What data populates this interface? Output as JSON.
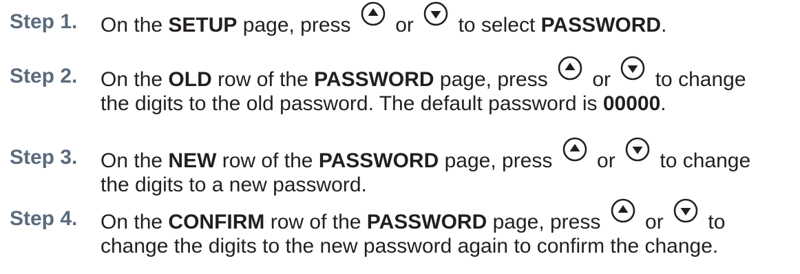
{
  "steps": [
    {
      "label": "Step 1.",
      "lines": [
        [
          {
            "t": "On the "
          },
          {
            "b": "SETUP"
          },
          {
            "t": " page, press "
          },
          {
            "icon": "up-arrow-button-icon"
          },
          {
            "t": " or "
          },
          {
            "icon": "down-arrow-button-icon"
          },
          {
            "t": " to select "
          },
          {
            "b": "PASSWORD"
          },
          {
            "t": "."
          }
        ]
      ]
    },
    {
      "label": "Step 2.",
      "lines": [
        [
          {
            "t": "On the "
          },
          {
            "b": "OLD"
          },
          {
            "t": " row of the "
          },
          {
            "b": "PASSWORD"
          },
          {
            "t": " page, press "
          },
          {
            "icon": "up-arrow-button-icon"
          },
          {
            "t": " or "
          },
          {
            "icon": "down-arrow-button-icon"
          },
          {
            "t": " to change"
          }
        ],
        [
          {
            "t": "the digits to the old password. The default password is "
          },
          {
            "b": "00000"
          },
          {
            "t": "."
          }
        ]
      ]
    },
    {
      "label": "Step 3.",
      "lines": [
        [
          {
            "t": "On the "
          },
          {
            "b": "NEW"
          },
          {
            "t": " row of the "
          },
          {
            "b": "PASSWORD"
          },
          {
            "t": " page, press "
          },
          {
            "icon": "up-arrow-button-icon"
          },
          {
            "t": " or "
          },
          {
            "icon": "down-arrow-button-icon"
          },
          {
            "t": " to change"
          }
        ],
        [
          {
            "t": "the digits to a new password."
          }
        ]
      ]
    },
    {
      "label": "Step 4.",
      "lines": [
        [
          {
            "t": "On the "
          },
          {
            "b": "CONFIRM"
          },
          {
            "t": " row of the "
          },
          {
            "b": "PASSWORD"
          },
          {
            "t": " page, press "
          },
          {
            "icon": "up-arrow-button-icon"
          },
          {
            "t": " or "
          },
          {
            "icon": "down-arrow-button-icon"
          },
          {
            "t": " to"
          }
        ],
        [
          {
            "t": "change the digits to the new password again to confirm the change."
          }
        ]
      ]
    }
  ],
  "colors": {
    "label": "#5b6b7d",
    "text": "#231f20"
  }
}
